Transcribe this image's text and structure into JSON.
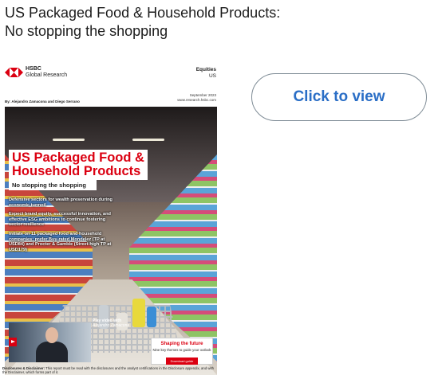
{
  "headline": {
    "line1": "US Packaged Food & Household Products:",
    "line2": "No stopping the shopping"
  },
  "report": {
    "brand_name": "HSBC",
    "brand_sub": "Global Research",
    "section": "Equities",
    "region": "US",
    "byline": "By: Alejandro Zamacona and Diego Serrano",
    "date": "September 2023",
    "website": "www.research.hsbc.com",
    "title_line1": "US Packaged Food &",
    "title_line2": "Household Products",
    "subtitle": "No stopping the shopping",
    "bullets": [
      "Defensive sectors for wealth preservation during economic turmoil",
      "Expect brand equity, successful innovation, and effective ESG ambitions to continue fostering sector resilience",
      "Initiate on 11 packaged food and household companies; prefer Buy-rated Mondelez (TP at USD84) and Procter & Gamble (Street-high TP at USD179)"
    ],
    "video_label": "Play video with",
    "video_presenter": "Alejandro Zamacona",
    "cta_title": "Shaping the future",
    "cta_subtitle": "Nine key themes to guide your outlook",
    "cta_button": "Download guide",
    "disclosure_bold": "Disclosures & Disclaimer:",
    "disclosure_text": "This report must be read with the disclosures and the analyst certifications in the Disclosure appendix, and with the Disclaimer, which forms part of it."
  },
  "click_button": {
    "label": "Click to view"
  },
  "colors": {
    "hsbc_red": "#db0011",
    "link_blue": "#2a6ec6"
  }
}
